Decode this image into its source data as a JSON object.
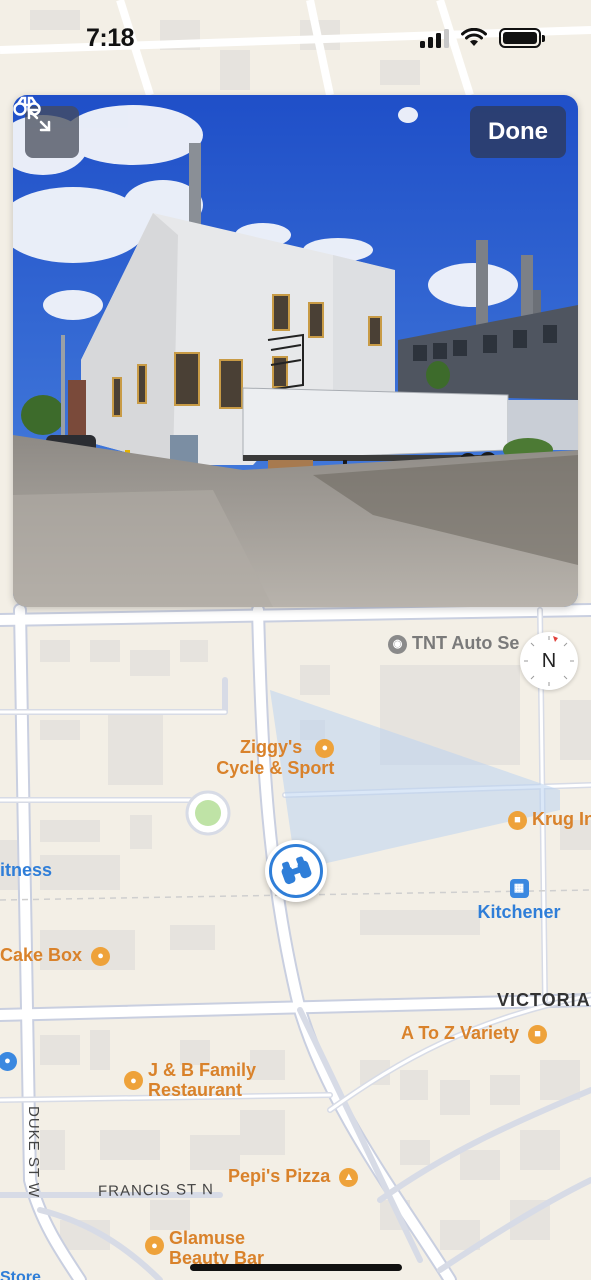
{
  "status": {
    "time": "7:18"
  },
  "look_around": {
    "done_label": "Done",
    "expand_icon": "expand-icon",
    "binoculars_icon": "binoculars-icon"
  },
  "compass": {
    "letter": "N"
  },
  "map": {
    "pois": {
      "tnt": "TNT Auto Se",
      "ziggys_line1": "Ziggy's",
      "ziggys_line2": "Cycle & Sport",
      "krug": "Krug In",
      "fitness": "itness",
      "kitchener": "Kitchener",
      "cake_box": "Cake Box",
      "a_to_z": "A To Z Variety",
      "jb_line1": "J & B Family",
      "jb_line2": "Restaurant",
      "pepis": "Pepi's Pizza",
      "glamuse_line1": "Glamuse",
      "glamuse_line2": "Beauty Bar",
      "store": "Store"
    },
    "streets": {
      "victoria": "VICTORIA",
      "francis": "FRANCIS ST N",
      "duke": "DUKE ST W",
      "duke_top": "DUKE ST"
    }
  },
  "colors": {
    "accent": "#2f7ed8",
    "poi_orange": "#d9822b",
    "map_bg": "#f3efe6",
    "road": "#ffffff",
    "road_edge": "#c9cfe0"
  }
}
